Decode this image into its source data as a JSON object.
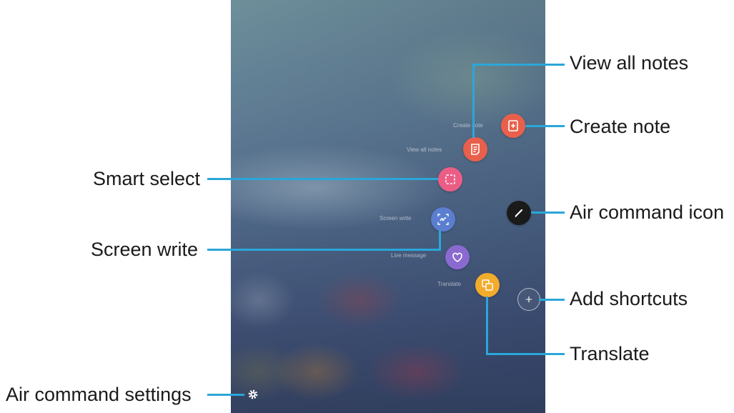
{
  "callouts": {
    "view_all_notes": "View all notes",
    "create_note": "Create note",
    "smart_select": "Smart select",
    "air_command_icon": "Air command icon",
    "screen_write": "Screen write",
    "add_shortcuts": "Add shortcuts",
    "translate": "Translate",
    "air_command_settings": "Air command settings"
  },
  "menu_labels": {
    "create_note": "Create note",
    "view_all_notes": "View all notes",
    "screen_write": "Screen write",
    "live_message": "Live message",
    "translate": "Translate"
  },
  "icons": {
    "create_note": "note-add-icon",
    "view_all_notes": "notes-list-icon",
    "smart_select": "smart-select-icon",
    "air_command": "pen-icon",
    "screen_write": "screen-write-icon",
    "live_message": "heart-icon",
    "translate": "translate-icon",
    "add_shortcuts": "plus-icon",
    "settings": "gear-icon"
  },
  "colors": {
    "leader_line": "#2aa7d9",
    "create_note": "#e8604c",
    "view_all_notes": "#e8604c",
    "smart_select": "#ec5d86",
    "screen_write": "#5b7ed0",
    "live_message": "#8a6ad0",
    "translate": "#f2ac2c",
    "air_command": "#1a1a1a"
  }
}
